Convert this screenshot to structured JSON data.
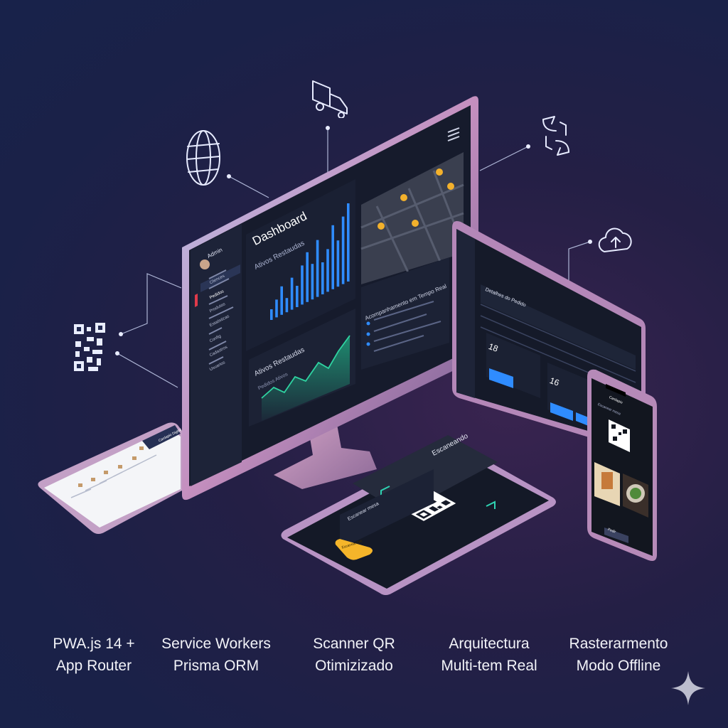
{
  "monitor": {
    "user": "Admin",
    "dashboard_title": "Dashboard",
    "sidebar": [
      "Cliences",
      "Pedidos",
      "Produtos",
      "Estatisticas",
      "Config",
      "Cadastros",
      "Usuarios"
    ],
    "bar_panel_title": "Ativos Restaudas",
    "area_panel_title": "Ativos Restaudas",
    "area_panel_sub": "Pedidos Ativos",
    "realtime_panel_title": "Acompanhamento em Tempo Real"
  },
  "tablet": {
    "title": "Detalhes do Pedido",
    "stat1": "18",
    "stat2": "16"
  },
  "pad": {
    "title": "Escaneando",
    "panel_title": "Escanear mesa",
    "button": "Escanear QR"
  },
  "phone_left": {
    "title": "Cardapio Digital"
  },
  "phone_right": {
    "title": "Cardapio",
    "subtitle": "Escanear mesa",
    "button": "Pedir"
  },
  "features": [
    {
      "line1": "PWA.js 14 +",
      "line2": "App Router"
    },
    {
      "line1": "Service Workers",
      "line2": "Prisma ORM"
    },
    {
      "line1": "Scanner QR",
      "line2": "Otimizizado"
    },
    {
      "line1": "Arquitectura",
      "line2": "Multi-tem Real"
    },
    {
      "line1": "Rasterarmento",
      "line2": "Modo Offline"
    }
  ],
  "icons": [
    "globe-icon",
    "truck-icon",
    "sync-icon",
    "cloud-sync-icon",
    "qr-code-icon",
    "sparkle-icon"
  ],
  "colors": {
    "accent_blue": "#2f8cff",
    "map_pin": "#f3b12c",
    "button_yellow": "#f5b52a",
    "area_green": "#1f9e7a"
  },
  "chart_data": {
    "type": "bar",
    "values": [
      3,
      5,
      8,
      4,
      9,
      6,
      11,
      14,
      10,
      16,
      9,
      12,
      18,
      13,
      19,
      22
    ]
  }
}
